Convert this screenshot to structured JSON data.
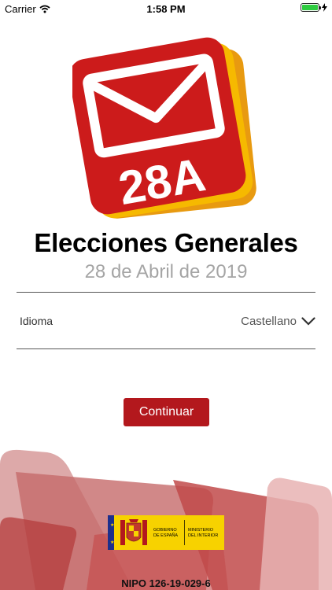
{
  "status_bar": {
    "carrier": "Carrier",
    "time": "1:58 PM",
    "battery_level": 1.0
  },
  "logo": {
    "text": "28A",
    "primary_color": "#cc1b1b",
    "accent_color": "#f6b900"
  },
  "header": {
    "title": "Elecciones Generales",
    "subtitle": "28 de Abril de 2019"
  },
  "language": {
    "label": "Idioma",
    "value": "Castellano"
  },
  "actions": {
    "continue_label": "Continuar"
  },
  "footer": {
    "gov_left_line1": "GOBIERNO",
    "gov_left_line2": "DE ESPAÑA",
    "gov_right_line1": "MINISTERIO",
    "gov_right_line2": "DEL INTERIOR",
    "nipo": "NIPO 126-19-029-6"
  },
  "colors": {
    "brand_red": "#b3181d",
    "gov_yellow": "#f7d200",
    "subtitle_gray": "#a5a5a5"
  }
}
